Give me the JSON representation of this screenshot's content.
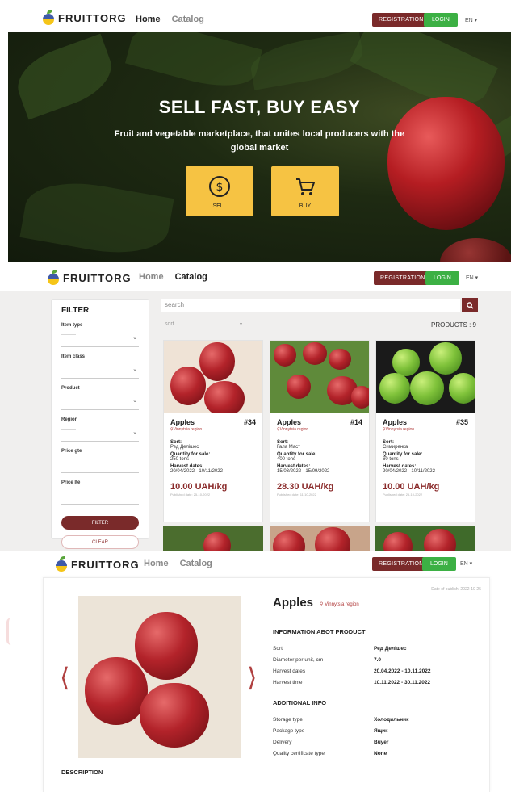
{
  "brand": {
    "name": "FRUITTORG"
  },
  "header": {
    "nav_home": "Home",
    "nav_catalog": "Catalog",
    "registration": "REGISTRATION",
    "login": "LOGIN",
    "language": "EN ▾"
  },
  "hero": {
    "title": "SELL FAST, BUY EASY",
    "subtitle": "Fruit and vegetable marketplace, that unites local producers with the global market",
    "sell_label": "SELL",
    "buy_label": "BUY",
    "accent": "#f6c343"
  },
  "filter": {
    "title": "FILTER",
    "item_type_label": "Item type",
    "item_type_value": "---------",
    "item_class_label": "Item class",
    "product_label": "Product",
    "region_label": "Region",
    "region_value": "---------",
    "price_gte_label": "Price gte",
    "price_lte_label": "Price lte",
    "filter_button": "FILTER",
    "clear_button": "CLEAR"
  },
  "catalog": {
    "search_placeholder": "search",
    "sort_placeholder": "sort",
    "products_count": "PRODUCTS : 9",
    "cards": [
      {
        "name": "Apples",
        "id": "#34",
        "region": "Vinnytsia region",
        "sort_label": "Sort:",
        "sort": "Ред Делішес",
        "qty_label": "Quantity for sale:",
        "qty": "250 tons",
        "harvest_label": "Harvest dates:",
        "harvest": "20/04/2022 - 10/11/2022",
        "price": "10.00 UAH/kg",
        "published": "Published date: 25-10-2022"
      },
      {
        "name": "Apples",
        "id": "#14",
        "region": "Vinnytsia region",
        "sort_label": "Sort:",
        "sort": "Гала Маст",
        "qty_label": "Quantity for sale:",
        "qty": "400 tons",
        "harvest_label": "Harvest dates:",
        "harvest": "15/03/2022 - 15/09/2022",
        "price": "28.30 UAH/kg",
        "published": "Published date: 11-10-2022"
      },
      {
        "name": "Apples",
        "id": "#35",
        "region": "Vinnytsia region",
        "sort_label": "Sort:",
        "sort": "Симиренка",
        "qty_label": "Quantity for sale:",
        "qty": "60 tons",
        "harvest_label": "Harvest dates:",
        "harvest": "20/04/2022 - 10/11/2022",
        "price": "10.00 UAH/kg",
        "published": "Published date: 25-10-2022"
      }
    ]
  },
  "detail": {
    "publish_date": "Date of publish: 2022-10-25",
    "title": "Apples",
    "region": "Vinnytsia region",
    "info_heading": "INFORMATION ABOT PRODUCT",
    "info": [
      {
        "k": "Sort",
        "v": "Ред Делішес"
      },
      {
        "k": "Diameter per unit, cm",
        "v": "7.0"
      },
      {
        "k": "Harvest dates",
        "v": "20.04.2022 - 10.11.2022"
      },
      {
        "k": "Harvest time",
        "v": "10.11.2022 - 30.11.2022"
      }
    ],
    "additional_heading": "ADDITIONAL INFO",
    "additional": [
      {
        "k": "Storage type",
        "v": "Холодильник"
      },
      {
        "k": "Package type",
        "v": "Ящик"
      },
      {
        "k": "Delivery",
        "v": "Buyer"
      },
      {
        "k": "Quality certificate type",
        "v": "None"
      }
    ],
    "description_heading": "DESCRIPTION"
  },
  "colors": {
    "brand_red": "#7a2a2a",
    "login_green": "#3cb044",
    "price_red": "#8a2a2a"
  }
}
